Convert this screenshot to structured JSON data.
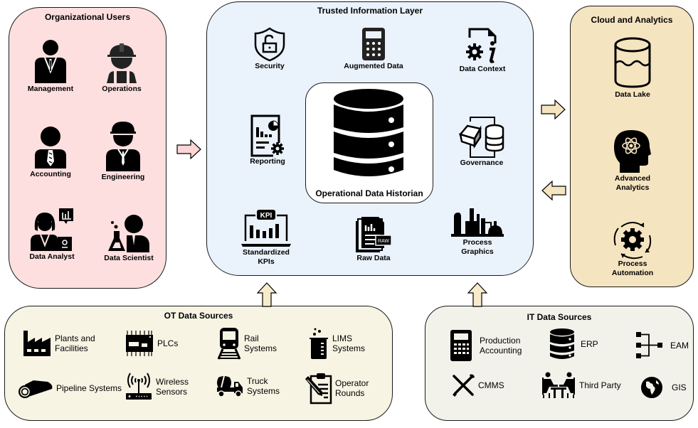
{
  "panels": {
    "org": {
      "title": "Organizational Users",
      "items": [
        {
          "label": "Management",
          "icon": "manager-icon"
        },
        {
          "label": "Operations",
          "icon": "hardhat-worker-icon"
        },
        {
          "label": "Accounting",
          "icon": "accountant-icon"
        },
        {
          "label": "Engineering",
          "icon": "engineer-icon"
        },
        {
          "label": "Data Analyst",
          "icon": "data-analyst-icon"
        },
        {
          "label": "Data Scientist",
          "icon": "data-scientist-icon"
        }
      ]
    },
    "til": {
      "title": "Trusted Information Layer",
      "center_label": "Operational Data Historian",
      "items": [
        {
          "label": "Security",
          "icon": "shield-lock-icon"
        },
        {
          "label": "Augmented Data",
          "icon": "calculator-icon"
        },
        {
          "label": "Data Context",
          "icon": "document-gear-info-icon"
        },
        {
          "label": "Reporting",
          "icon": "report-chart-gear-icon"
        },
        {
          "label": "Governance",
          "icon": "box-database-icon"
        },
        {
          "label": "Standardized",
          "label2": "KPIs",
          "icon": "kpi-laptop-icon"
        },
        {
          "label": "Raw Data",
          "icon": "raw-document-icon"
        },
        {
          "label": "Process",
          "label2": "Graphics",
          "icon": "industrial-plant-icon"
        }
      ]
    },
    "cloud": {
      "title": "Cloud and Analytics",
      "items": [
        {
          "label": "Data Lake",
          "icon": "data-lake-icon"
        },
        {
          "label": "Advanced",
          "label2": "Analytics",
          "icon": "brain-atom-icon"
        },
        {
          "label": "Process",
          "label2": "Automation",
          "icon": "gear-cycle-icon"
        }
      ]
    },
    "ot": {
      "title": "OT Data Sources",
      "items": [
        {
          "label": "Plants and",
          "label2": "Facilities",
          "icon": "factory-icon"
        },
        {
          "label": "PLCs",
          "icon": "plc-chip-icon"
        },
        {
          "label": "Rail",
          "label2": "Systems",
          "icon": "train-icon"
        },
        {
          "label": "LIMS",
          "label2": "Systems",
          "icon": "beaker-icon"
        },
        {
          "label": "Pipeline Systems",
          "icon": "pipeline-icon"
        },
        {
          "label": "Wireless",
          "label2": "Sensors",
          "icon": "wireless-router-icon"
        },
        {
          "label": "Truck",
          "label2": "Systems",
          "icon": "mixer-truck-icon"
        },
        {
          "label": "Operator",
          "label2": "Rounds",
          "icon": "clipboard-pencil-icon"
        }
      ]
    },
    "it": {
      "title": "IT Data Sources",
      "items": [
        {
          "label": "Production",
          "label2": "Accounting",
          "icon": "calculator-icon"
        },
        {
          "label": "ERP",
          "icon": "database-icon"
        },
        {
          "label": "EAM",
          "icon": "hierarchy-icon"
        },
        {
          "label": "CMMS",
          "icon": "wrench-screwdriver-icon"
        },
        {
          "label": "Third Party",
          "icon": "meeting-table-icon"
        },
        {
          "label": "GIS",
          "icon": "globe-icon"
        }
      ]
    }
  },
  "colors": {
    "org_bg": "#fddfdf",
    "til_bg": "#eaf2fc",
    "cloud_bg": "#f5e4c0",
    "ot_bg": "#f7f4e4",
    "it_bg": "#f2f2ea",
    "arrow_pink": "#fdd5d5",
    "arrow_tan": "#f5e4c0"
  },
  "arrows": [
    {
      "name": "org-to-til-arrow",
      "direction": "right"
    },
    {
      "name": "til-to-cloud-arrow",
      "direction": "right"
    },
    {
      "name": "cloud-to-til-arrow",
      "direction": "left"
    },
    {
      "name": "ot-to-til-arrow",
      "direction": "up"
    },
    {
      "name": "it-to-til-arrow",
      "direction": "up"
    }
  ]
}
